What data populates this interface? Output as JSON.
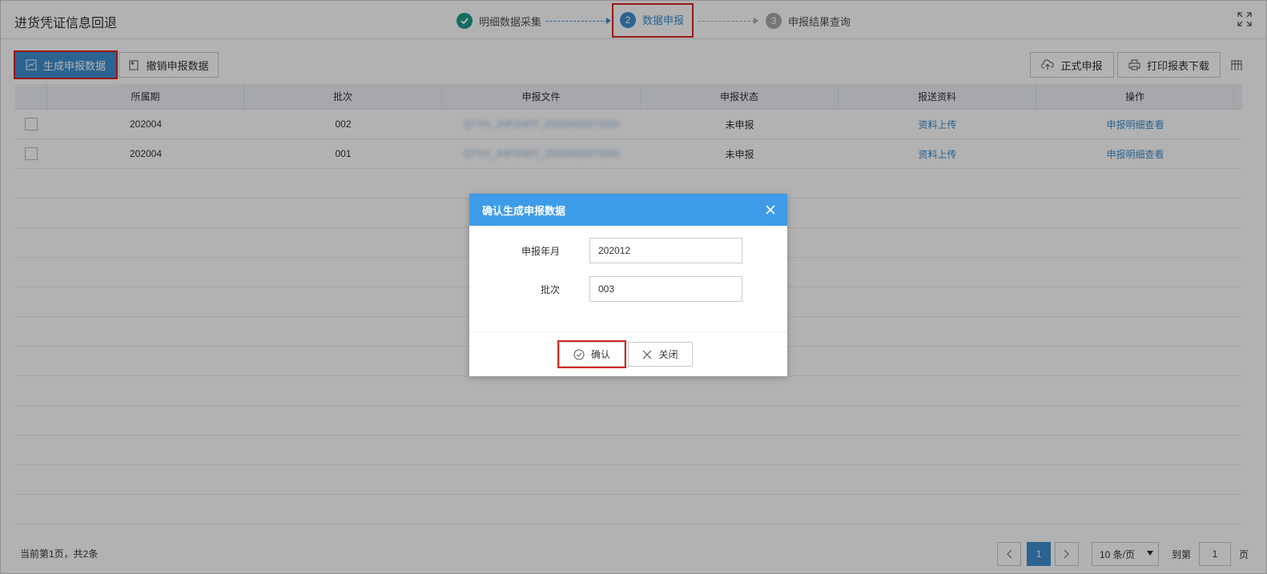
{
  "header": {
    "title": "进货凭证信息回退",
    "steps": [
      {
        "label": "明细数据采集",
        "number": "",
        "state": "done"
      },
      {
        "label": "数据申报",
        "number": "2",
        "state": "active"
      },
      {
        "label": "申报结果查询",
        "number": "3",
        "state": "todo"
      }
    ]
  },
  "toolbar": {
    "generate_label": "生成申报数据",
    "revoke_label": "撤销申报数据",
    "formal_label": "正式申报",
    "print_label": "打印报表下载"
  },
  "table": {
    "columns": [
      "所属期",
      "批次",
      "申报文件",
      "申报状态",
      "报送资料",
      "操作"
    ],
    "rows": [
      {
        "period": "202004",
        "batch": "002",
        "file": "QTYH_JHPZHHT_20200420073305",
        "status": "未申报",
        "upload": "资料上传",
        "action": "申报明细查看"
      },
      {
        "period": "202004",
        "batch": "001",
        "file": "QTYH_JHPZHHT_20200420073305",
        "status": "未申报",
        "upload": "资料上传",
        "action": "申报明细查看"
      }
    ]
  },
  "footer": {
    "info": "当前第1页，共2条",
    "current_page": "1",
    "page_size": "10 条/页",
    "goto_label": "到第",
    "goto_value": "1",
    "page_unit": "页"
  },
  "modal": {
    "title": "确认生成申报数据",
    "period_label": "申报年月",
    "period_value": "202012",
    "batch_label": "批次",
    "batch_value": "003",
    "confirm_label": "确认",
    "close_label": "关闭"
  },
  "colors": {
    "accent": "#3e8ed0",
    "modal_header": "#3e9be8",
    "done_step": "#1f9b8a",
    "highlight": "#d9241f"
  }
}
